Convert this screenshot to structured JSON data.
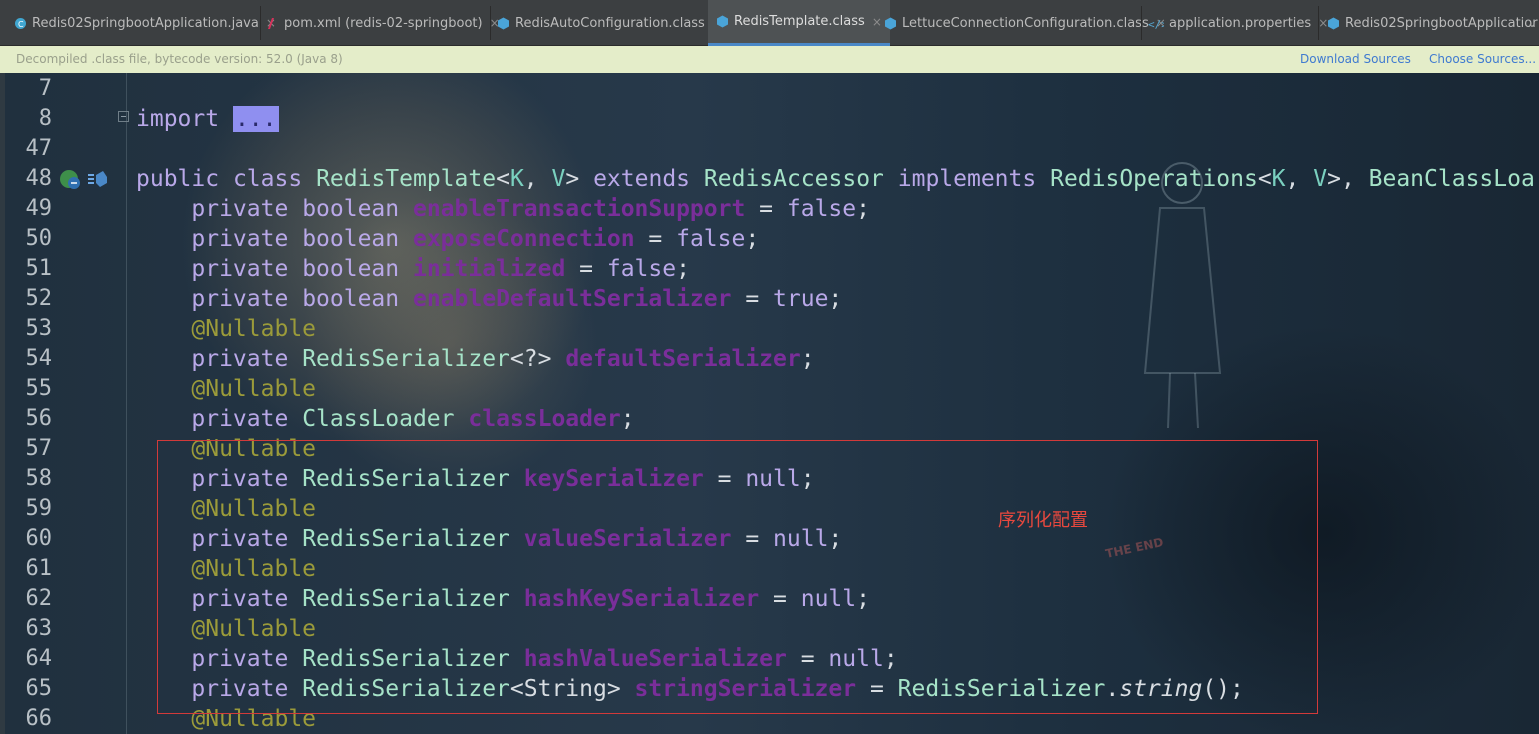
{
  "tabs": [
    {
      "label": "Redis02SpringbootApplication.java",
      "icon": "java-class-icon",
      "active": false
    },
    {
      "label": "pom.xml (redis-02-springboot)",
      "icon": "maven-icon",
      "active": false
    },
    {
      "label": "RedisAutoConfiguration.class",
      "icon": "class-file-icon",
      "active": false
    },
    {
      "label": "RedisTemplate.class",
      "icon": "class-file-icon",
      "active": true
    },
    {
      "label": "LettuceConnectionConfiguration.class",
      "icon": "class-file-icon",
      "active": false
    },
    {
      "label": "application.properties",
      "icon": "properties-icon",
      "active": false
    },
    {
      "label": "Redis02SpringbootApplicatior",
      "icon": "class-file-icon",
      "active": false
    }
  ],
  "tab_close_glyph": "×",
  "banner": {
    "message": "Decompiled .class file, bytecode version: 52.0 (Java 8)",
    "download_sources": "Download Sources",
    "choose_sources": "Choose Sources..."
  },
  "line_numbers": [
    "7",
    "8",
    "47",
    "48",
    "49",
    "50",
    "51",
    "52",
    "53",
    "54",
    "55",
    "56",
    "57",
    "58",
    "59",
    "60",
    "61",
    "62",
    "63",
    "64",
    "65",
    "66"
  ],
  "code": {
    "l8": {
      "import": "import",
      "fold": "..."
    },
    "l48": {
      "public": "public",
      "class": "class",
      "name": "RedisTemplate",
      "lt": "<",
      "k": "K",
      "comma": ", ",
      "v": "V",
      "gt": ">",
      "extends": "extends",
      "parent": "RedisAccessor",
      "implements": "implements",
      "iface": "RedisOperations",
      "lt2": "<",
      "k2": "K",
      "comma2": ", ",
      "v2": "V",
      "gt2": ">, ",
      "iface2": "BeanClassLoa"
    },
    "l49": {
      "mod": "private",
      "type": "boolean",
      "field": "enableTransactionSupport",
      "eq": " = ",
      "val": "false",
      "semi": ";"
    },
    "l50": {
      "mod": "private",
      "type": "boolean",
      "field": "exposeConnection",
      "eq": " = ",
      "val": "false",
      "semi": ";"
    },
    "l51": {
      "mod": "private",
      "type": "boolean",
      "field": "initialized",
      "eq": " = ",
      "val": "false",
      "semi": ";"
    },
    "l52": {
      "mod": "private",
      "type": "boolean",
      "field": "enableDefaultSerializer",
      "eq": " = ",
      "val": "true",
      "semi": ";"
    },
    "l53": {
      "ann": "@Nullable"
    },
    "l54": {
      "mod": "private",
      "type": "RedisSerializer",
      "gen": "<?>",
      "field": "defaultSerializer",
      "semi": ";"
    },
    "l55": {
      "ann": "@Nullable"
    },
    "l56": {
      "mod": "private",
      "type": "ClassLoader",
      "field": "classLoader",
      "semi": ";"
    },
    "l57": {
      "ann": "@Nullable"
    },
    "l58": {
      "mod": "private",
      "type": "RedisSerializer",
      "field": "keySerializer",
      "eq": " = ",
      "val": "null",
      "semi": ";"
    },
    "l59": {
      "ann": "@Nullable"
    },
    "l60": {
      "mod": "private",
      "type": "RedisSerializer",
      "field": "valueSerializer",
      "eq": " = ",
      "val": "null",
      "semi": ";"
    },
    "l61": {
      "ann": "@Nullable"
    },
    "l62": {
      "mod": "private",
      "type": "RedisSerializer",
      "field": "hashKeySerializer",
      "eq": " = ",
      "val": "null",
      "semi": ";"
    },
    "l63": {
      "ann": "@Nullable"
    },
    "l64": {
      "mod": "private",
      "type": "RedisSerializer",
      "field": "hashValueSerializer",
      "eq": " = ",
      "val": "null",
      "semi": ";"
    },
    "l65": {
      "mod": "private",
      "type": "RedisSerializer",
      "gen": "<String>",
      "field": "stringSerializer",
      "eq": " = ",
      "cls": "RedisSerializer",
      "dot": ".",
      "method": "string",
      "call": "();"
    },
    "l66": {
      "ann": "@Nullable"
    }
  },
  "annotation_label": "序列化配置",
  "watermark": "THE END",
  "colors": {
    "highlight_box": "#d23a3a",
    "active_tab_underline": "#4a88c7",
    "banner_bg": "#e4edc9"
  }
}
